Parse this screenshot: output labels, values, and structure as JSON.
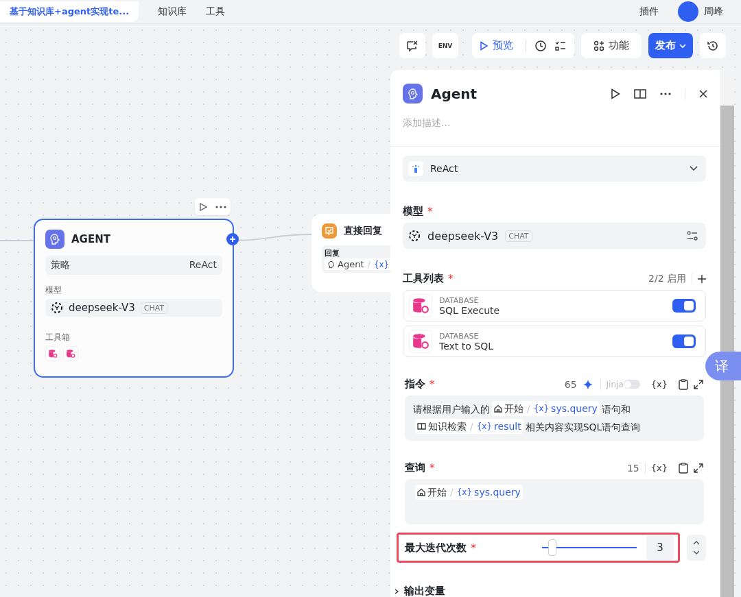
{
  "top_nav": {
    "project_title": "基于知识库+agent实现te...",
    "tabs": [
      {
        "label": "知识库",
        "selected": false
      },
      {
        "label": "工具",
        "selected": false
      }
    ],
    "plugins": "插件",
    "user_name": "周峰"
  },
  "toolbar": {
    "env_button": "ENV",
    "preview": "预览",
    "features": "功能",
    "publish": "发布"
  },
  "canvas": {
    "agent_node": {
      "title": "AGENT",
      "strategy_label": "策略",
      "strategy_value": "ReAct",
      "model_label": "模型",
      "model_name": "deepseek-V3",
      "model_tag": "CHAT",
      "toolbox_label": "工具箱"
    },
    "reply_node": {
      "title": "直接回复",
      "field_label": "回复",
      "source": "Agent",
      "separator": "/",
      "var_mark": "{x}"
    }
  },
  "panel": {
    "title": "Agent",
    "description_placeholder": "添加描述...",
    "strategy": "ReAct",
    "model": {
      "label": "模型",
      "mark": "*",
      "name": "deepseek-V3",
      "tag": "CHAT"
    },
    "tools": {
      "label": "工具列表",
      "mark": "*",
      "count": "2/2 启用",
      "items": [
        {
          "category": "DATABASE",
          "name": "SQL Execute",
          "enabled": true
        },
        {
          "category": "DATABASE",
          "name": "Text to SQL",
          "enabled": true
        }
      ]
    },
    "instruction": {
      "label": "指令",
      "mark": "*",
      "count": "65",
      "jinja_label": "Jinja",
      "jinja_on": false,
      "var_button": "{x}",
      "segments": [
        {
          "kind": "text",
          "text": "请根据用户输入的"
        },
        {
          "kind": "start_ref",
          "node": "开始",
          "separator": "/",
          "var_mark": "{x}",
          "var": "sys.query"
        },
        {
          "kind": "text",
          "text": "语句和"
        },
        {
          "kind": "knowledge_ref",
          "node": "知识检索",
          "separator": "/",
          "var_mark": "{x}",
          "var": "result"
        },
        {
          "kind": "text",
          "text": "相关内容实现SQL语句查询"
        }
      ]
    },
    "query": {
      "label": "查询",
      "mark": "*",
      "count": "15",
      "var_button": "{x}",
      "segments": [
        {
          "kind": "start_ref",
          "node": "开始",
          "separator": "/",
          "var_mark": "{x}",
          "var": "sys.query"
        }
      ]
    },
    "max_iterations": {
      "label": "最大迭代次数",
      "mark": "*",
      "level": 0.08,
      "value": "3",
      "highlighted": true
    },
    "output_label": "输出变量"
  },
  "translate_button": "译"
}
